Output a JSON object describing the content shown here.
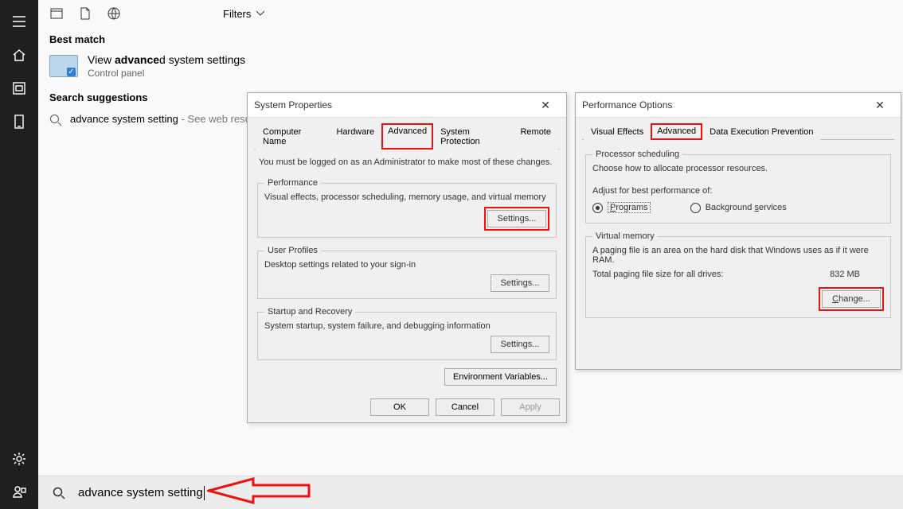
{
  "leftbar": {
    "items": [
      "menu",
      "home",
      "recent",
      "device"
    ],
    "bottom": [
      "gear",
      "user"
    ]
  },
  "top": {
    "filters_label": "Filters"
  },
  "sections": {
    "best_match": "Best match",
    "search_suggestions": "Search suggestions"
  },
  "result": {
    "title_pre": "View ",
    "title_bold": "advance",
    "title_post": "d system settings",
    "sub": "Control panel"
  },
  "suggestion": {
    "query": "advance system setting",
    "extra": " - See web results"
  },
  "searchbar": {
    "value": "advance system setting"
  },
  "sysprops": {
    "title": "System Properties",
    "tabs": [
      "Computer Name",
      "Hardware",
      "Advanced",
      "System Protection",
      "Remote"
    ],
    "active": "Advanced",
    "note": "You must be logged on as an Administrator to make most of these changes.",
    "perf": {
      "legend": "Performance",
      "desc": "Visual effects, processor scheduling, memory usage, and virtual memory",
      "btn": "Settings..."
    },
    "profiles": {
      "legend": "User Profiles",
      "desc": "Desktop settings related to your sign-in",
      "btn": "Settings..."
    },
    "startup": {
      "legend": "Startup and Recovery",
      "desc": "System startup, system failure, and debugging information",
      "btn": "Settings..."
    },
    "env_btn": "Environment Variables...",
    "ok": "OK",
    "cancel": "Cancel",
    "apply": "Apply"
  },
  "perfopts": {
    "title": "Performance Options",
    "tabs": [
      "Visual Effects",
      "Advanced",
      "Data Execution Prevention"
    ],
    "active": "Advanced",
    "proc": {
      "legend": "Processor scheduling",
      "desc": "Choose how to allocate processor resources.",
      "label": "Adjust for best performance of:",
      "opt1": "Programs",
      "opt2": "Background services",
      "selected": "Programs"
    },
    "vm": {
      "legend": "Virtual memory",
      "desc": "A paging file is an area on the hard disk that Windows uses as if it were RAM.",
      "total_label": "Total paging file size for all drives:",
      "total_value": "832 MB",
      "btn": "Change..."
    }
  }
}
